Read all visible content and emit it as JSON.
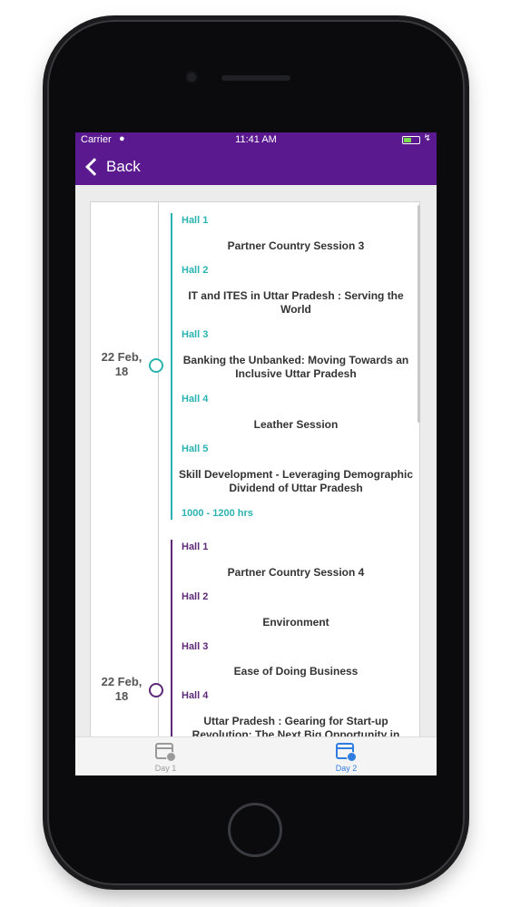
{
  "status_bar": {
    "carrier": "Carrier",
    "time": "11:41 AM"
  },
  "nav": {
    "back_label": "Back"
  },
  "groups": [
    {
      "date": "22 Feb, 18",
      "color": "#2ab3b0",
      "sessions": [
        {
          "hall": "Hall 1",
          "title": "Partner Country Session 3"
        },
        {
          "hall": "Hall 2",
          "title": "IT and ITES in Uttar Pradesh : Serving the World"
        },
        {
          "hall": "Hall 3",
          "title": "Banking the Unbanked: Moving Towards an Inclusive Uttar Pradesh"
        },
        {
          "hall": "Hall 4",
          "title": "Leather Session"
        },
        {
          "hall": "Hall 5",
          "title": "Skill Development - Leveraging Demographic Dividend of Uttar Pradesh"
        }
      ],
      "time": "1000 - 1200 hrs"
    },
    {
      "date": "22 Feb, 18",
      "color": "#5e2a78",
      "sessions": [
        {
          "hall": "Hall 1",
          "title": "Partner Country Session 4"
        },
        {
          "hall": "Hall 2",
          "title": "Environment"
        },
        {
          "hall": "Hall 3",
          "title": "Ease of Doing Business"
        },
        {
          "hall": "Hall 4",
          "title": "Uttar Pradesh : Gearing for Start-up Revolution: The Next Big Opportunity in"
        }
      ]
    }
  ],
  "tabs": [
    {
      "label": "Day 1",
      "color": "#9a9a9a"
    },
    {
      "label": "Day 2",
      "color": "#2f7de0"
    }
  ]
}
